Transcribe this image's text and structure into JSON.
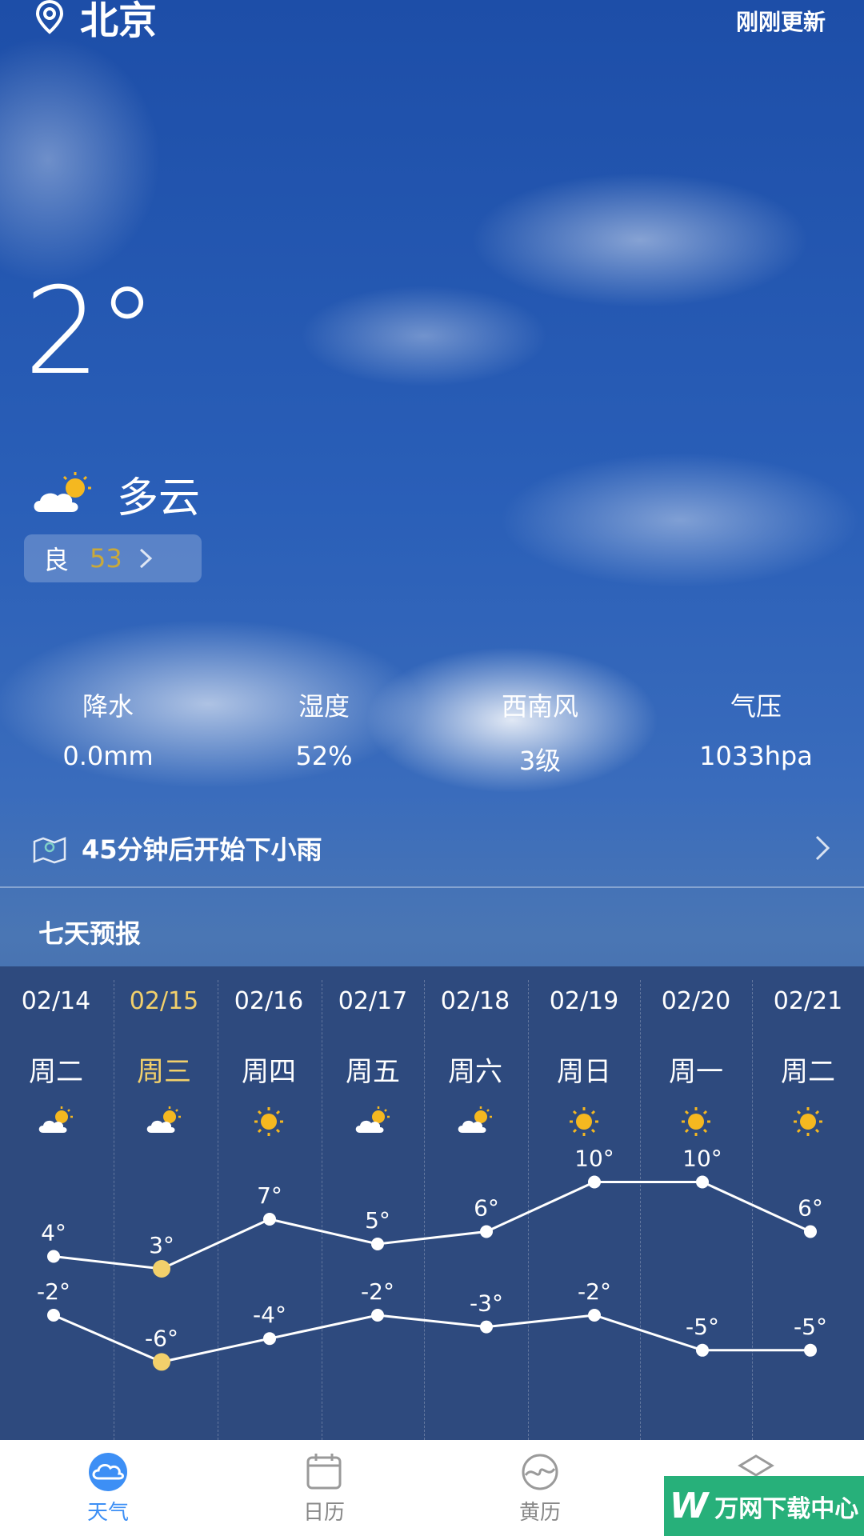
{
  "header": {
    "city": "北京",
    "update_text": "刚刚更新",
    "location_icon": "location-pin-icon"
  },
  "current": {
    "temperature": "2°",
    "condition": "多云",
    "condition_icon": "partly-cloudy-icon",
    "aqi_label": "良",
    "aqi_value": "53"
  },
  "stats": [
    {
      "label": "降水",
      "value": "0.0mm"
    },
    {
      "label": "湿度",
      "value": "52%"
    },
    {
      "label": "西南风",
      "value": "3级"
    },
    {
      "label": "气压",
      "value": "1033hpa"
    }
  ],
  "rain_alert": {
    "text": "45分钟后开始下小雨",
    "icon": "map-pin-icon"
  },
  "forecast": {
    "title": "七天预报",
    "days": [
      {
        "date": "02/14",
        "dow": "周二",
        "icon": "partly-cloudy-icon",
        "high": 4,
        "low": -2,
        "high_label": "4°",
        "low_label": "-2°"
      },
      {
        "date": "02/15",
        "dow": "周三",
        "icon": "partly-cloudy-icon",
        "high": 3,
        "low": -6,
        "high_label": "3°",
        "low_label": "-6°",
        "today": true
      },
      {
        "date": "02/16",
        "dow": "周四",
        "icon": "sunny-icon",
        "high": 7,
        "low": -4,
        "high_label": "7°",
        "low_label": "-4°"
      },
      {
        "date": "02/17",
        "dow": "周五",
        "icon": "partly-cloudy-icon",
        "high": 5,
        "low": -2,
        "high_label": "5°",
        "low_label": "-2°"
      },
      {
        "date": "02/18",
        "dow": "周六",
        "icon": "partly-cloudy-icon",
        "high": 6,
        "low": -3,
        "high_label": "6°",
        "low_label": "-3°"
      },
      {
        "date": "02/19",
        "dow": "周日",
        "icon": "sunny-icon",
        "high": 10,
        "low": -2,
        "high_label": "10°",
        "low_label": "-2°"
      },
      {
        "date": "02/20",
        "dow": "周一",
        "icon": "sunny-icon",
        "high": 10,
        "low": -5,
        "high_label": "10°",
        "low_label": "-5°"
      },
      {
        "date": "02/21",
        "dow": "周二",
        "icon": "sunny-icon",
        "high": 6,
        "low": -5,
        "high_label": "6°",
        "low_label": "-5°"
      }
    ]
  },
  "tabs": [
    {
      "label": "天气",
      "icon": "weather-icon",
      "active": true
    },
    {
      "label": "日历",
      "icon": "calendar-icon",
      "active": false
    },
    {
      "label": "黄历",
      "icon": "almanac-icon",
      "active": false
    },
    {
      "label": "",
      "icon": "more-icon",
      "active": false
    }
  ],
  "watermark": {
    "text": "万网下载中心",
    "logo": "W"
  },
  "colors": {
    "accent": "#3d8ff5",
    "today": "#f2d06b",
    "sun": "#f5b820",
    "aqi": "#c9a93a"
  }
}
